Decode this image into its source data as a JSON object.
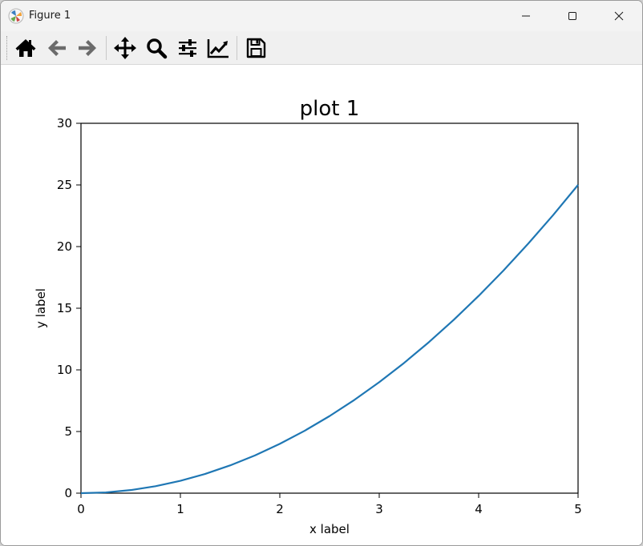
{
  "window": {
    "title": "Figure 1",
    "controls": {
      "minimize": "minimize-icon",
      "maximize": "maximize-icon",
      "close": "close-icon"
    }
  },
  "toolbar": {
    "buttons": [
      {
        "name": "home",
        "icon": "home-icon"
      },
      {
        "name": "back",
        "icon": "arrow-left-icon"
      },
      {
        "name": "forward",
        "icon": "arrow-right-icon"
      },
      {
        "name": "pan",
        "icon": "move-icon"
      },
      {
        "name": "zoom",
        "icon": "magnifier-icon"
      },
      {
        "name": "configure-subplots",
        "icon": "sliders-icon"
      },
      {
        "name": "edit-axis",
        "icon": "line-chart-icon"
      },
      {
        "name": "save",
        "icon": "floppy-disk-icon"
      }
    ],
    "icon_color": "#000000",
    "disabled_color": "#6b6b6b"
  },
  "chart_data": {
    "type": "line",
    "title": "plot 1",
    "xlabel": "x label",
    "ylabel": "y label",
    "xlim": [
      0,
      5
    ],
    "ylim": [
      0,
      30
    ],
    "xticks": [
      0,
      1,
      2,
      3,
      4,
      5
    ],
    "yticks": [
      0,
      5,
      10,
      15,
      20,
      25,
      30
    ],
    "grid": false,
    "series": [
      {
        "color": "#1f77b4",
        "x": [
          0,
          0.25,
          0.5,
          0.75,
          1,
          1.25,
          1.5,
          1.75,
          2,
          2.25,
          2.5,
          2.75,
          3,
          3.25,
          3.5,
          3.75,
          4,
          4.25,
          4.5,
          4.75,
          5
        ],
        "y": [
          0,
          0.0625,
          0.25,
          0.5625,
          1,
          1.5625,
          2.25,
          3.0625,
          4,
          5.0625,
          6.25,
          7.5625,
          9,
          10.5625,
          12.25,
          14.0625,
          16,
          18.0625,
          20.25,
          22.5625,
          25
        ]
      }
    ]
  }
}
